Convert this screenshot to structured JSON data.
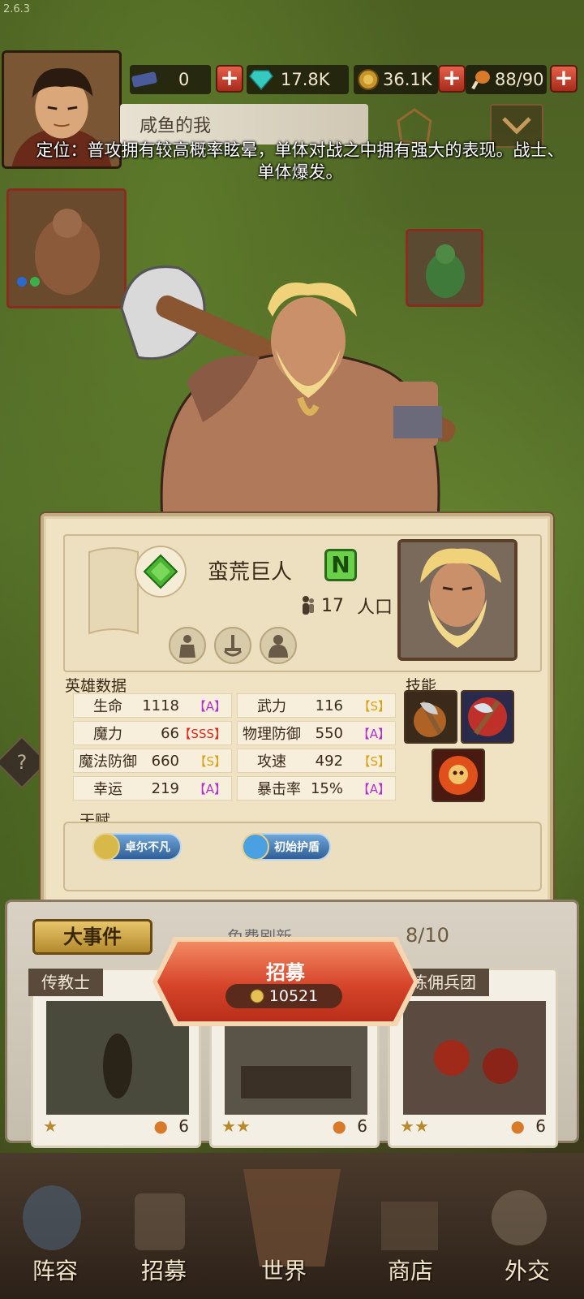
{
  "version": "2.6.3",
  "resources": {
    "ticket": "0",
    "gems": "17.8K",
    "gold": "36.1K",
    "food": "88/90"
  },
  "player_name": "咸鱼的我",
  "hero_description": "定位：普攻拥有较高概率眩晕，单体对战之中拥有强大的表现。战士、单体爆发。",
  "hero": {
    "name": "蛮荒巨人",
    "grade": "N",
    "population": "17",
    "population_label": "人口"
  },
  "sections": {
    "stats_label": "英雄数据",
    "skills_label": "技能",
    "talent_label": "天赋"
  },
  "stats": [
    {
      "label": "生命",
      "value": "1118",
      "grade": "【A】"
    },
    {
      "label": "武力",
      "value": "116",
      "grade": "【S】"
    },
    {
      "label": "魔力",
      "value": "66",
      "grade": "【SSS】"
    },
    {
      "label": "物理防御",
      "value": "550",
      "grade": "【A】"
    },
    {
      "label": "魔法防御",
      "value": "660",
      "grade": "【S】"
    },
    {
      "label": "攻速",
      "value": "492",
      "grade": "【S】"
    },
    {
      "label": "幸运",
      "value": "219",
      "grade": "【A】"
    },
    {
      "label": "暴击率",
      "value": "15%",
      "grade": "【A】"
    }
  ],
  "skills": [
    "axe-strike-icon",
    "double-axe-icon",
    "flame-skull-icon"
  ],
  "talents": [
    "卓尔不凡",
    "初始护盾"
  ],
  "recruit": {
    "event_label": "大事件",
    "refresh_label": "免费刷新",
    "count": "8/10",
    "button_label": "招募",
    "cost": "10521",
    "cards": [
      {
        "title": "传教士",
        "stars": 1,
        "cost": "6"
      },
      {
        "title": "",
        "stars": 2,
        "cost": "6"
      },
      {
        "title": "练佣兵团",
        "stars": 2,
        "cost": "6"
      }
    ]
  },
  "nav": [
    "阵容",
    "招募",
    "世界",
    "商店",
    "外交"
  ],
  "colors": {
    "grade_A": "#b42fd0",
    "grade_S": "#d9a011",
    "grade_SSS": "#e2271b",
    "accent_red": "#d6442a",
    "grade_N": "#6bd04a"
  }
}
